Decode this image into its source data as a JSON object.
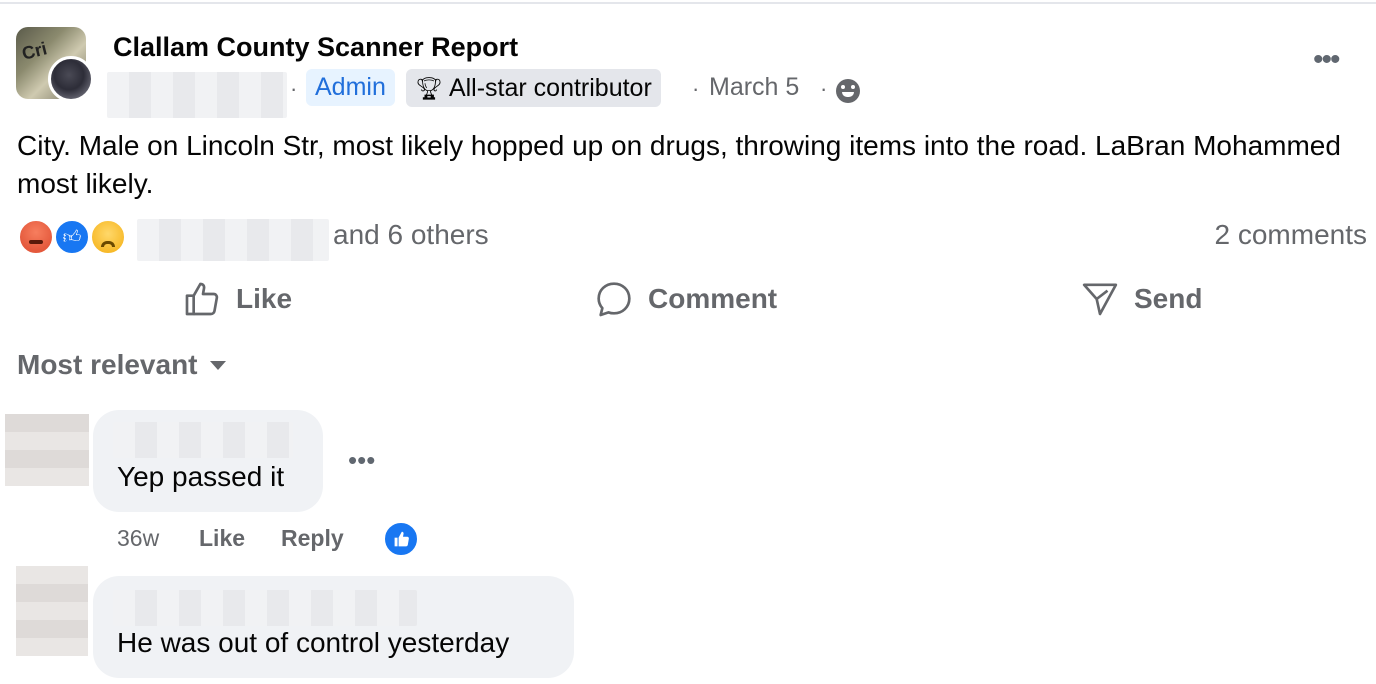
{
  "post": {
    "group_name": "Clallam County Scanner Report",
    "admin_badge": "Admin",
    "allstar_badge": "All-star contributor",
    "date": "March 5",
    "text": "City. Male on Lincoln Str, most likely hopped up on drugs, throwing items into the road. LaBran Mohammed most likely.",
    "reactors_suffix": "and 6 others",
    "comments_count": "2 comments",
    "reactions": [
      "angry",
      "like",
      "sad"
    ]
  },
  "actions": {
    "like": "Like",
    "comment": "Comment",
    "send": "Send"
  },
  "comments_sort": "Most relevant",
  "comments": [
    {
      "text": "Yep passed it",
      "time": "36w",
      "like_label": "Like",
      "reply_label": "Reply"
    },
    {
      "text": "He was out of control yesterday"
    }
  ],
  "colors": {
    "accent": "#1877f2",
    "admin_text": "#216fdb",
    "secondary_text": "#65676b",
    "bubble_bg": "#f0f2f5"
  }
}
